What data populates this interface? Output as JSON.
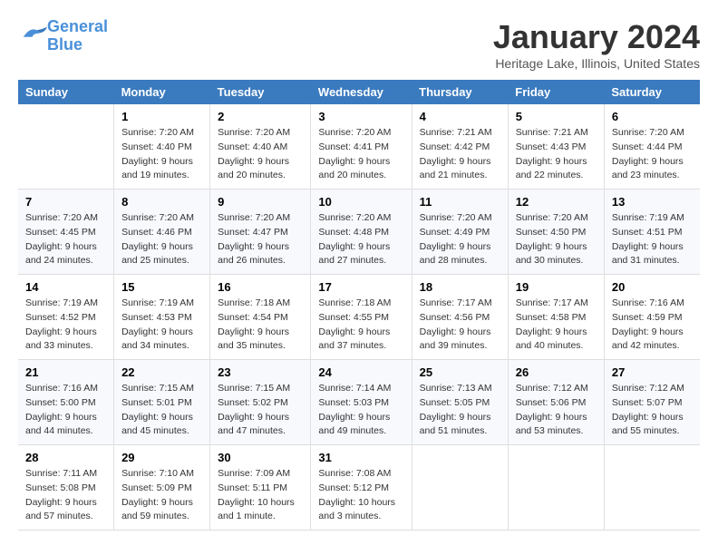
{
  "logo": {
    "line1": "General",
    "line2": "Blue"
  },
  "title": "January 2024",
  "location": "Heritage Lake, Illinois, United States",
  "days_of_week": [
    "Sunday",
    "Monday",
    "Tuesday",
    "Wednesday",
    "Thursday",
    "Friday",
    "Saturday"
  ],
  "weeks": [
    [
      {
        "day": "",
        "info": ""
      },
      {
        "day": "1",
        "info": "Sunrise: 7:20 AM\nSunset: 4:40 PM\nDaylight: 9 hours\nand 19 minutes."
      },
      {
        "day": "2",
        "info": "Sunrise: 7:20 AM\nSunset: 4:40 AM\nDaylight: 9 hours\nand 20 minutes."
      },
      {
        "day": "3",
        "info": "Sunrise: 7:20 AM\nSunset: 4:41 PM\nDaylight: 9 hours\nand 20 minutes."
      },
      {
        "day": "4",
        "info": "Sunrise: 7:21 AM\nSunset: 4:42 PM\nDaylight: 9 hours\nand 21 minutes."
      },
      {
        "day": "5",
        "info": "Sunrise: 7:21 AM\nSunset: 4:43 PM\nDaylight: 9 hours\nand 22 minutes."
      },
      {
        "day": "6",
        "info": "Sunrise: 7:20 AM\nSunset: 4:44 PM\nDaylight: 9 hours\nand 23 minutes."
      }
    ],
    [
      {
        "day": "7",
        "info": "Sunrise: 7:20 AM\nSunset: 4:45 PM\nDaylight: 9 hours\nand 24 minutes."
      },
      {
        "day": "8",
        "info": "Sunrise: 7:20 AM\nSunset: 4:46 PM\nDaylight: 9 hours\nand 25 minutes."
      },
      {
        "day": "9",
        "info": "Sunrise: 7:20 AM\nSunset: 4:47 PM\nDaylight: 9 hours\nand 26 minutes."
      },
      {
        "day": "10",
        "info": "Sunrise: 7:20 AM\nSunset: 4:48 PM\nDaylight: 9 hours\nand 27 minutes."
      },
      {
        "day": "11",
        "info": "Sunrise: 7:20 AM\nSunset: 4:49 PM\nDaylight: 9 hours\nand 28 minutes."
      },
      {
        "day": "12",
        "info": "Sunrise: 7:20 AM\nSunset: 4:50 PM\nDaylight: 9 hours\nand 30 minutes."
      },
      {
        "day": "13",
        "info": "Sunrise: 7:19 AM\nSunset: 4:51 PM\nDaylight: 9 hours\nand 31 minutes."
      }
    ],
    [
      {
        "day": "14",
        "info": "Sunrise: 7:19 AM\nSunset: 4:52 PM\nDaylight: 9 hours\nand 33 minutes."
      },
      {
        "day": "15",
        "info": "Sunrise: 7:19 AM\nSunset: 4:53 PM\nDaylight: 9 hours\nand 34 minutes."
      },
      {
        "day": "16",
        "info": "Sunrise: 7:18 AM\nSunset: 4:54 PM\nDaylight: 9 hours\nand 35 minutes."
      },
      {
        "day": "17",
        "info": "Sunrise: 7:18 AM\nSunset: 4:55 PM\nDaylight: 9 hours\nand 37 minutes."
      },
      {
        "day": "18",
        "info": "Sunrise: 7:17 AM\nSunset: 4:56 PM\nDaylight: 9 hours\nand 39 minutes."
      },
      {
        "day": "19",
        "info": "Sunrise: 7:17 AM\nSunset: 4:58 PM\nDaylight: 9 hours\nand 40 minutes."
      },
      {
        "day": "20",
        "info": "Sunrise: 7:16 AM\nSunset: 4:59 PM\nDaylight: 9 hours\nand 42 minutes."
      }
    ],
    [
      {
        "day": "21",
        "info": "Sunrise: 7:16 AM\nSunset: 5:00 PM\nDaylight: 9 hours\nand 44 minutes."
      },
      {
        "day": "22",
        "info": "Sunrise: 7:15 AM\nSunset: 5:01 PM\nDaylight: 9 hours\nand 45 minutes."
      },
      {
        "day": "23",
        "info": "Sunrise: 7:15 AM\nSunset: 5:02 PM\nDaylight: 9 hours\nand 47 minutes."
      },
      {
        "day": "24",
        "info": "Sunrise: 7:14 AM\nSunset: 5:03 PM\nDaylight: 9 hours\nand 49 minutes."
      },
      {
        "day": "25",
        "info": "Sunrise: 7:13 AM\nSunset: 5:05 PM\nDaylight: 9 hours\nand 51 minutes."
      },
      {
        "day": "26",
        "info": "Sunrise: 7:12 AM\nSunset: 5:06 PM\nDaylight: 9 hours\nand 53 minutes."
      },
      {
        "day": "27",
        "info": "Sunrise: 7:12 AM\nSunset: 5:07 PM\nDaylight: 9 hours\nand 55 minutes."
      }
    ],
    [
      {
        "day": "28",
        "info": "Sunrise: 7:11 AM\nSunset: 5:08 PM\nDaylight: 9 hours\nand 57 minutes."
      },
      {
        "day": "29",
        "info": "Sunrise: 7:10 AM\nSunset: 5:09 PM\nDaylight: 9 hours\nand 59 minutes."
      },
      {
        "day": "30",
        "info": "Sunrise: 7:09 AM\nSunset: 5:11 PM\nDaylight: 10 hours\nand 1 minute."
      },
      {
        "day": "31",
        "info": "Sunrise: 7:08 AM\nSunset: 5:12 PM\nDaylight: 10 hours\nand 3 minutes."
      },
      {
        "day": "",
        "info": ""
      },
      {
        "day": "",
        "info": ""
      },
      {
        "day": "",
        "info": ""
      }
    ]
  ]
}
